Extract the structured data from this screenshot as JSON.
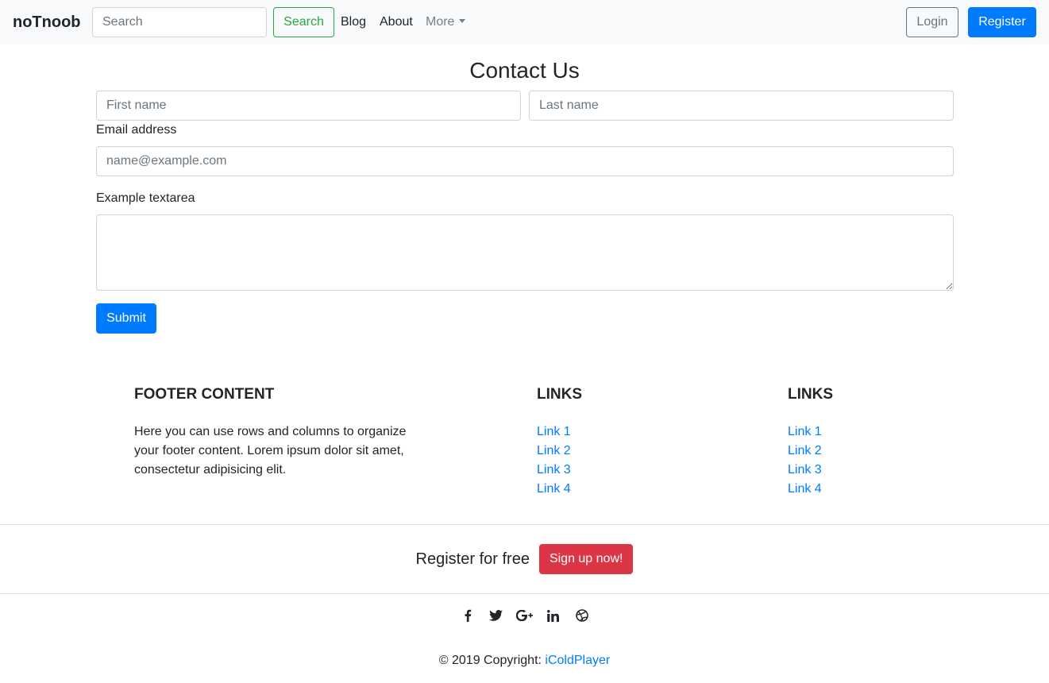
{
  "navbar": {
    "brand": "noTnoob",
    "search_placeholder": "Search",
    "search_button": "Search",
    "links": [
      "Blog",
      "About"
    ],
    "more_label": "More",
    "login_label": "Login",
    "register_label": "Register"
  },
  "contact": {
    "title": "Contact Us",
    "first_name_placeholder": "First name",
    "last_name_placeholder": "Last name",
    "email_label": "Email address",
    "email_placeholder": "name@example.com",
    "textarea_label": "Example textarea",
    "textarea_value": "",
    "submit_label": "Submit"
  },
  "footer": {
    "content_heading": "FOOTER CONTENT",
    "content_text": "Here you can use rows and columns to organize your footer content. Lorem ipsum dolor sit amet, consectetur adipisicing elit.",
    "link_columns": [
      {
        "heading": "LINKS",
        "links": [
          "Link 1",
          "Link 2",
          "Link 3",
          "Link 4"
        ]
      },
      {
        "heading": "LINKS",
        "links": [
          "Link 1",
          "Link 2",
          "Link 3",
          "Link 4"
        ]
      }
    ],
    "register_text": "Register for free",
    "signup_label": "Sign up now!",
    "social_icons": [
      "facebook-icon",
      "twitter-icon",
      "google-plus-icon",
      "linkedin-icon",
      "dribbble-icon"
    ],
    "copyright_prefix": "© 2019 Copyright:",
    "copyright_link": "iColdPlayer"
  },
  "colors": {
    "primary": "#007bff",
    "success": "#28a745",
    "danger": "#dc3545",
    "secondary": "#6c757d",
    "navbar_bg": "#f8f9fa"
  }
}
